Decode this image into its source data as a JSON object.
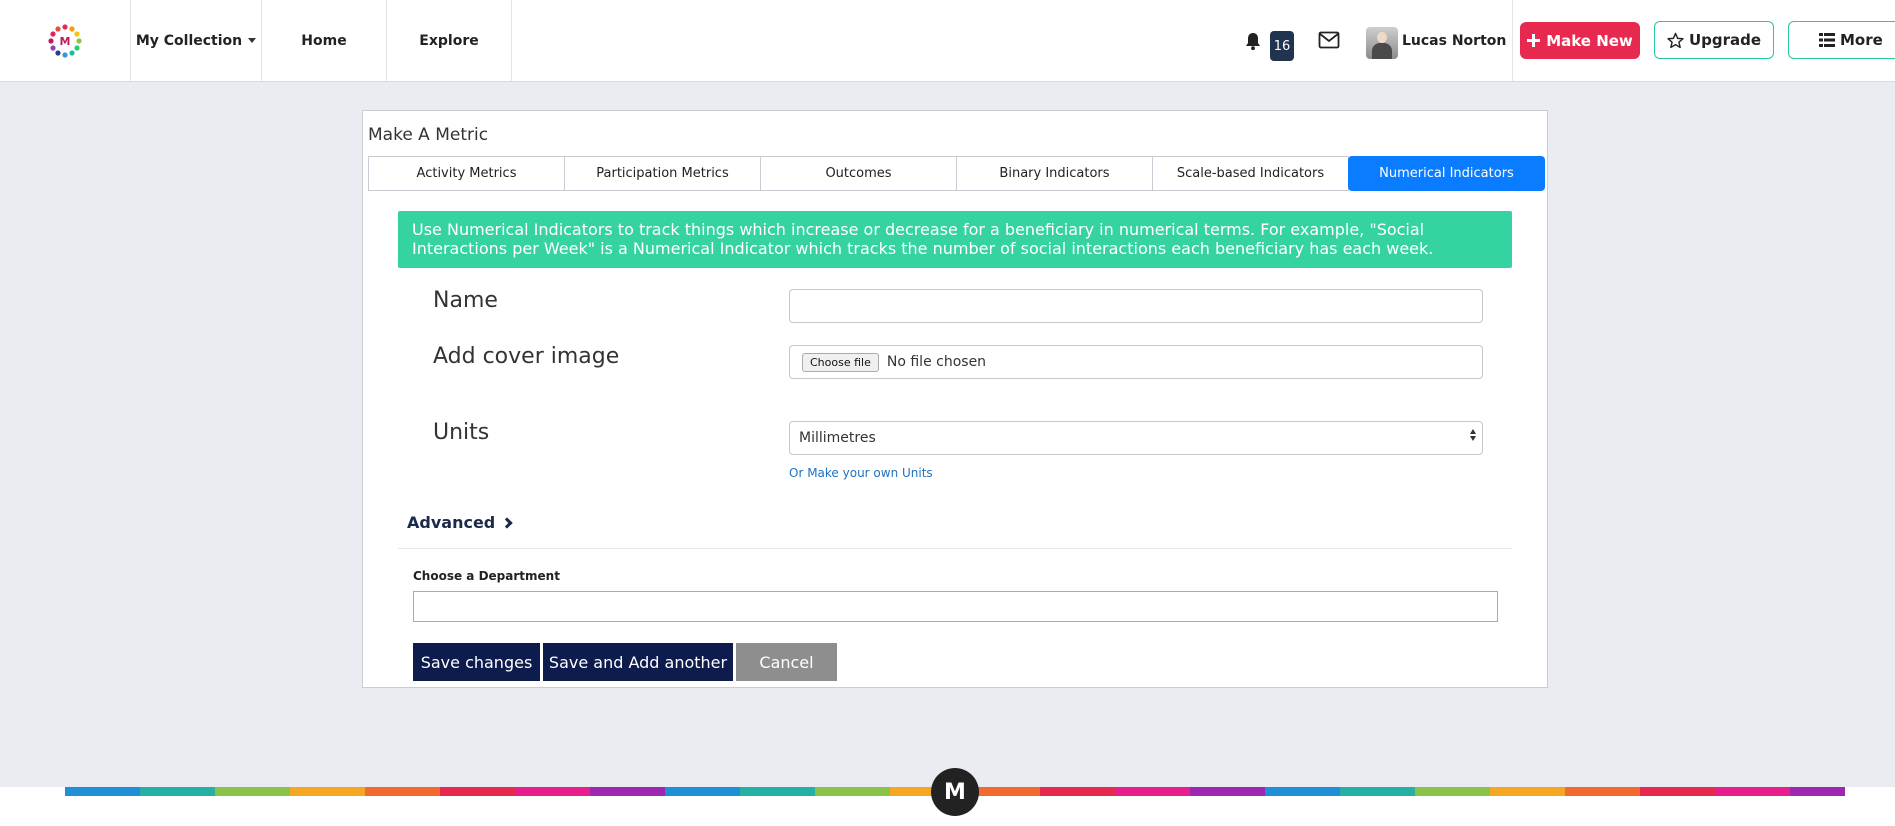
{
  "nav": {
    "collection_label": "My Collection",
    "home_label": "Home",
    "explore_label": "Explore",
    "notification_count": "16",
    "username": "Lucas Norton",
    "make_new_label": "Make New",
    "upgrade_label": "Upgrade",
    "more_label": "More"
  },
  "card": {
    "title": "Make A Metric",
    "tabs": [
      {
        "label": "Activity Metrics",
        "active": false
      },
      {
        "label": "Participation Metrics",
        "active": false
      },
      {
        "label": "Outcomes",
        "active": false
      },
      {
        "label": "Binary Indicators",
        "active": false
      },
      {
        "label": "Scale-based Indicators",
        "active": false
      },
      {
        "label": "Numerical Indicators",
        "active": true
      }
    ],
    "info_text": "Use Numerical Indicators to track things which increase or decrease for a beneficiary in numerical terms. For example, \"Social Interactions per Week\" is a Numerical Indicator which tracks the number of social interactions each beneficiary has each week."
  },
  "form": {
    "name_label": "Name",
    "name_value": "",
    "cover_label": "Add cover image",
    "file_button": "Choose file",
    "file_status": "No file chosen",
    "units_label": "Units",
    "units_selected": "Millimetres",
    "units_link": "Or Make your own Units",
    "advanced_label": "Advanced",
    "department_label": "Choose a Department",
    "department_value": ""
  },
  "actions": {
    "save": "Save changes",
    "save_add": "Save and Add another",
    "cancel": "Cancel"
  },
  "footer": {
    "logo_letter": "M"
  },
  "colors": {
    "brand_red": "#e8294f",
    "teal": "#2ac7a0",
    "info_green": "#34d3a1",
    "tab_active": "#0a7cff",
    "navy": "#0e1b4d",
    "badge": "#20334f"
  }
}
